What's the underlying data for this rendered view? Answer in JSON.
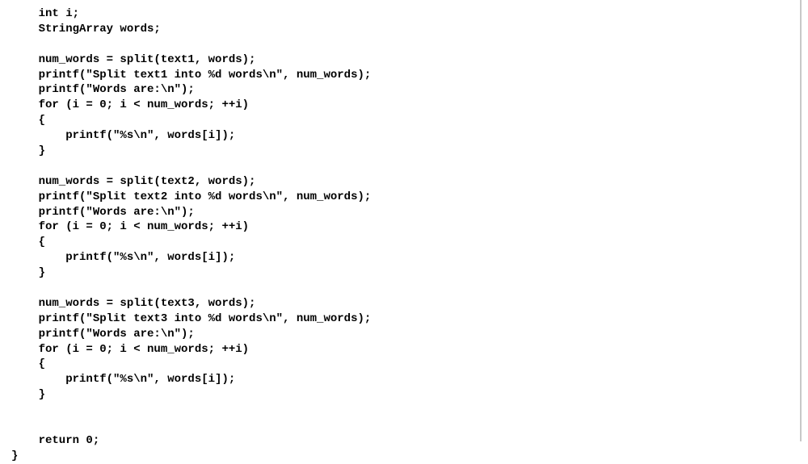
{
  "code": {
    "lines": [
      "    int i;",
      "    StringArray words;",
      "",
      "    num_words = split(text1, words);",
      "    printf(\"Split text1 into %d words\\n\", num_words);",
      "    printf(\"Words are:\\n\");",
      "    for (i = 0; i < num_words; ++i)",
      "    {",
      "        printf(\"%s\\n\", words[i]);",
      "    }",
      "",
      "    num_words = split(text2, words);",
      "    printf(\"Split text2 into %d words\\n\", num_words);",
      "    printf(\"Words are:\\n\");",
      "    for (i = 0; i < num_words; ++i)",
      "    {",
      "        printf(\"%s\\n\", words[i]);",
      "    }",
      "",
      "    num_words = split(text3, words);",
      "    printf(\"Split text3 into %d words\\n\", num_words);",
      "    printf(\"Words are:\\n\");",
      "    for (i = 0; i < num_words; ++i)",
      "    {",
      "        printf(\"%s\\n\", words[i]);",
      "    }",
      "",
      "",
      "    return 0;",
      "}"
    ]
  }
}
